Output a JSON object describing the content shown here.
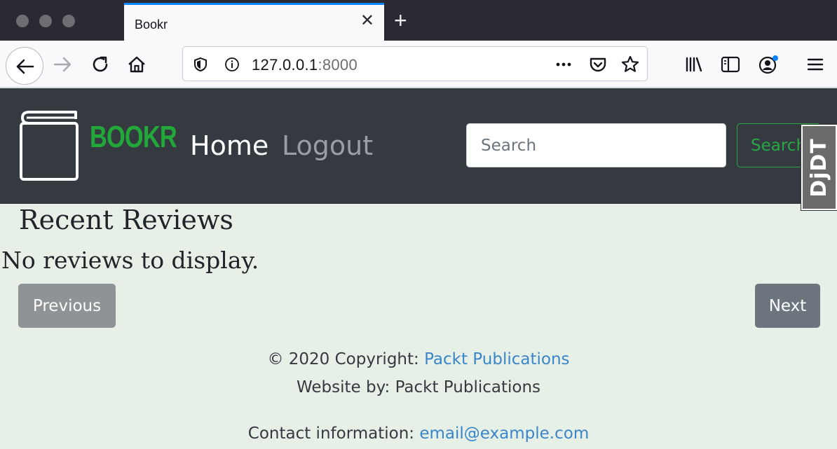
{
  "browser": {
    "tab_title": "Bookr",
    "url_host": "127.0.0.1",
    "url_port": ":8000",
    "tab_close_glyph": "✕",
    "new_tab_glyph": "+"
  },
  "site": {
    "brand": "BOOKR",
    "nav": {
      "home": "Home",
      "logout": "Logout"
    },
    "search": {
      "placeholder": "Search",
      "button": "Search"
    },
    "debug_toolbar": "DjDT"
  },
  "main": {
    "title": "Recent Reviews",
    "empty_message": "No reviews to display.",
    "pagination": {
      "previous": "Previous",
      "next": "Next"
    }
  },
  "footer": {
    "copyright_prefix": "© 2020 Copyright: ",
    "copyright_link": "Packt Publications",
    "website_by": "Website by: Packt Publications",
    "contact_prefix": "Contact information: ",
    "contact_email": "email@example.com"
  },
  "colors": {
    "header_bg": "#343a40",
    "brand_green": "#22a83a",
    "page_bg": "#e6f0e7",
    "link_blue": "#3a86c8"
  }
}
